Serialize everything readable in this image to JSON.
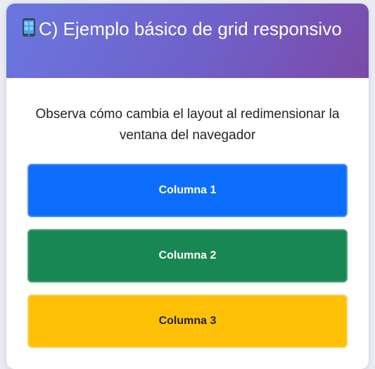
{
  "header": {
    "icon": "mobile-phone-icon",
    "title": "C) Ejemplo básico de grid responsivo"
  },
  "body": {
    "description": "Observa cómo cambia el layout al redimensionar la ventana del navegador"
  },
  "columns": [
    {
      "label": "Columna 1",
      "color": "#0d6efd"
    },
    {
      "label": "Columna 2",
      "color": "#198754"
    },
    {
      "label": "Columna 3",
      "color": "#ffc107"
    }
  ]
}
